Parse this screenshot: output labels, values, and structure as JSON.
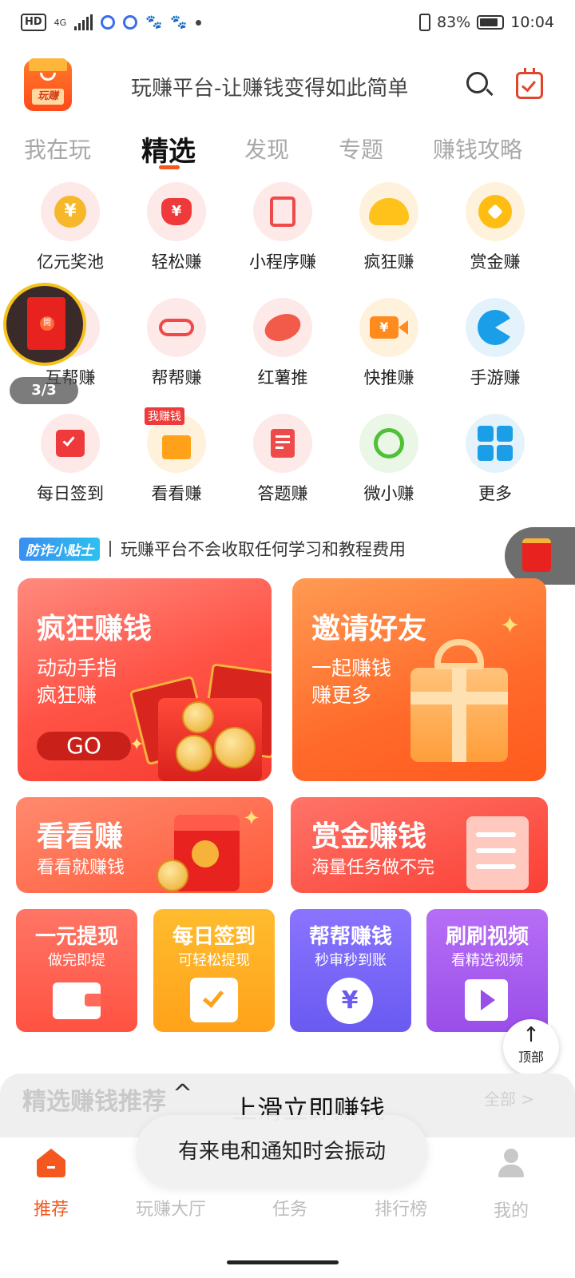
{
  "status_bar": {
    "hd": "HD",
    "network": "4G",
    "battery_pct": "83%",
    "battery_level": 0.83,
    "time": "10:04"
  },
  "header": {
    "logo_text": "玩赚",
    "title": "玩赚平台-让赚钱变得如此简单"
  },
  "tabs": [
    {
      "label": "我在玩",
      "active": false
    },
    {
      "label": "精选",
      "active": true
    },
    {
      "label": "发现",
      "active": false
    },
    {
      "label": "专题",
      "active": false
    },
    {
      "label": "赚钱攻略",
      "active": false
    }
  ],
  "grid": {
    "items": [
      {
        "label": "亿元奖池",
        "icon": "yuan-coin-icon"
      },
      {
        "label": "轻松赚",
        "icon": "money-bag-icon"
      },
      {
        "label": "小程序赚",
        "icon": "mini-program-icon"
      },
      {
        "label": "疯狂赚",
        "icon": "bowl-icon"
      },
      {
        "label": "赏金赚",
        "icon": "gold-coin-icon"
      },
      {
        "label": "互帮赚",
        "icon": "red-packet-icon"
      },
      {
        "label": "帮帮赚",
        "icon": "handshake-icon"
      },
      {
        "label": "红薯推",
        "icon": "sweet-potato-icon"
      },
      {
        "label": "快推赚",
        "icon": "video-camera-icon"
      },
      {
        "label": "手游赚",
        "icon": "game-icon"
      },
      {
        "label": "每日签到",
        "icon": "calendar-check-icon"
      },
      {
        "label": "看看赚",
        "icon": "video-envelope-icon",
        "badge": "我赚钱"
      },
      {
        "label": "答题赚",
        "icon": "quiz-icon"
      },
      {
        "label": "微小赚",
        "icon": "mini-app-icon"
      },
      {
        "label": "更多",
        "icon": "more-grid-icon"
      }
    ],
    "yuan_glyph": "¥"
  },
  "floating_redpacket": {
    "seal": "開",
    "count": "3/3"
  },
  "tip": {
    "badge": "防诈小贴士",
    "text": "玩赚平台不会收取任何学习和教程费用"
  },
  "big_cards": [
    {
      "title": "疯狂赚钱",
      "subtitle": "动动手指\n疯狂赚",
      "button": "GO"
    },
    {
      "title": "邀请好友",
      "subtitle": "一起赚钱\n赚更多"
    }
  ],
  "mid_cards": [
    {
      "title": "看看赚",
      "subtitle": "看看就赚钱"
    },
    {
      "title": "赏金赚钱",
      "subtitle": "海量任务做不完"
    }
  ],
  "small_cards": [
    {
      "title": "一元提现",
      "subtitle": "做完即提"
    },
    {
      "title": "每日签到",
      "subtitle": "可轻松提现"
    },
    {
      "title": "帮帮赚钱",
      "subtitle": "秒审秒到账"
    },
    {
      "title": "刷刷视频",
      "subtitle": "看精选视频"
    }
  ],
  "back_to_top": {
    "arrow": "↑",
    "label": "顶部"
  },
  "recommend": {
    "title": "精选赚钱推荐",
    "chevron": "^",
    "more": "全部 >",
    "swipe_hint": "上滑立即赚钱"
  },
  "toast": {
    "text": "有来电和通知时会振动"
  },
  "bottom_nav": [
    {
      "label": "推荐",
      "active": true
    },
    {
      "label": "玩赚大厅",
      "active": false
    },
    {
      "label": "任务",
      "active": false
    },
    {
      "label": "排行榜",
      "active": false
    },
    {
      "label": "我的",
      "active": false
    }
  ],
  "colors": {
    "accent": "#f4581f",
    "card_red": "#ff5346",
    "card_orange": "#ff6a2a",
    "card_yellow": "#ffa21a",
    "card_indigo": "#6a5af0",
    "card_purple": "#9a4ee8"
  }
}
